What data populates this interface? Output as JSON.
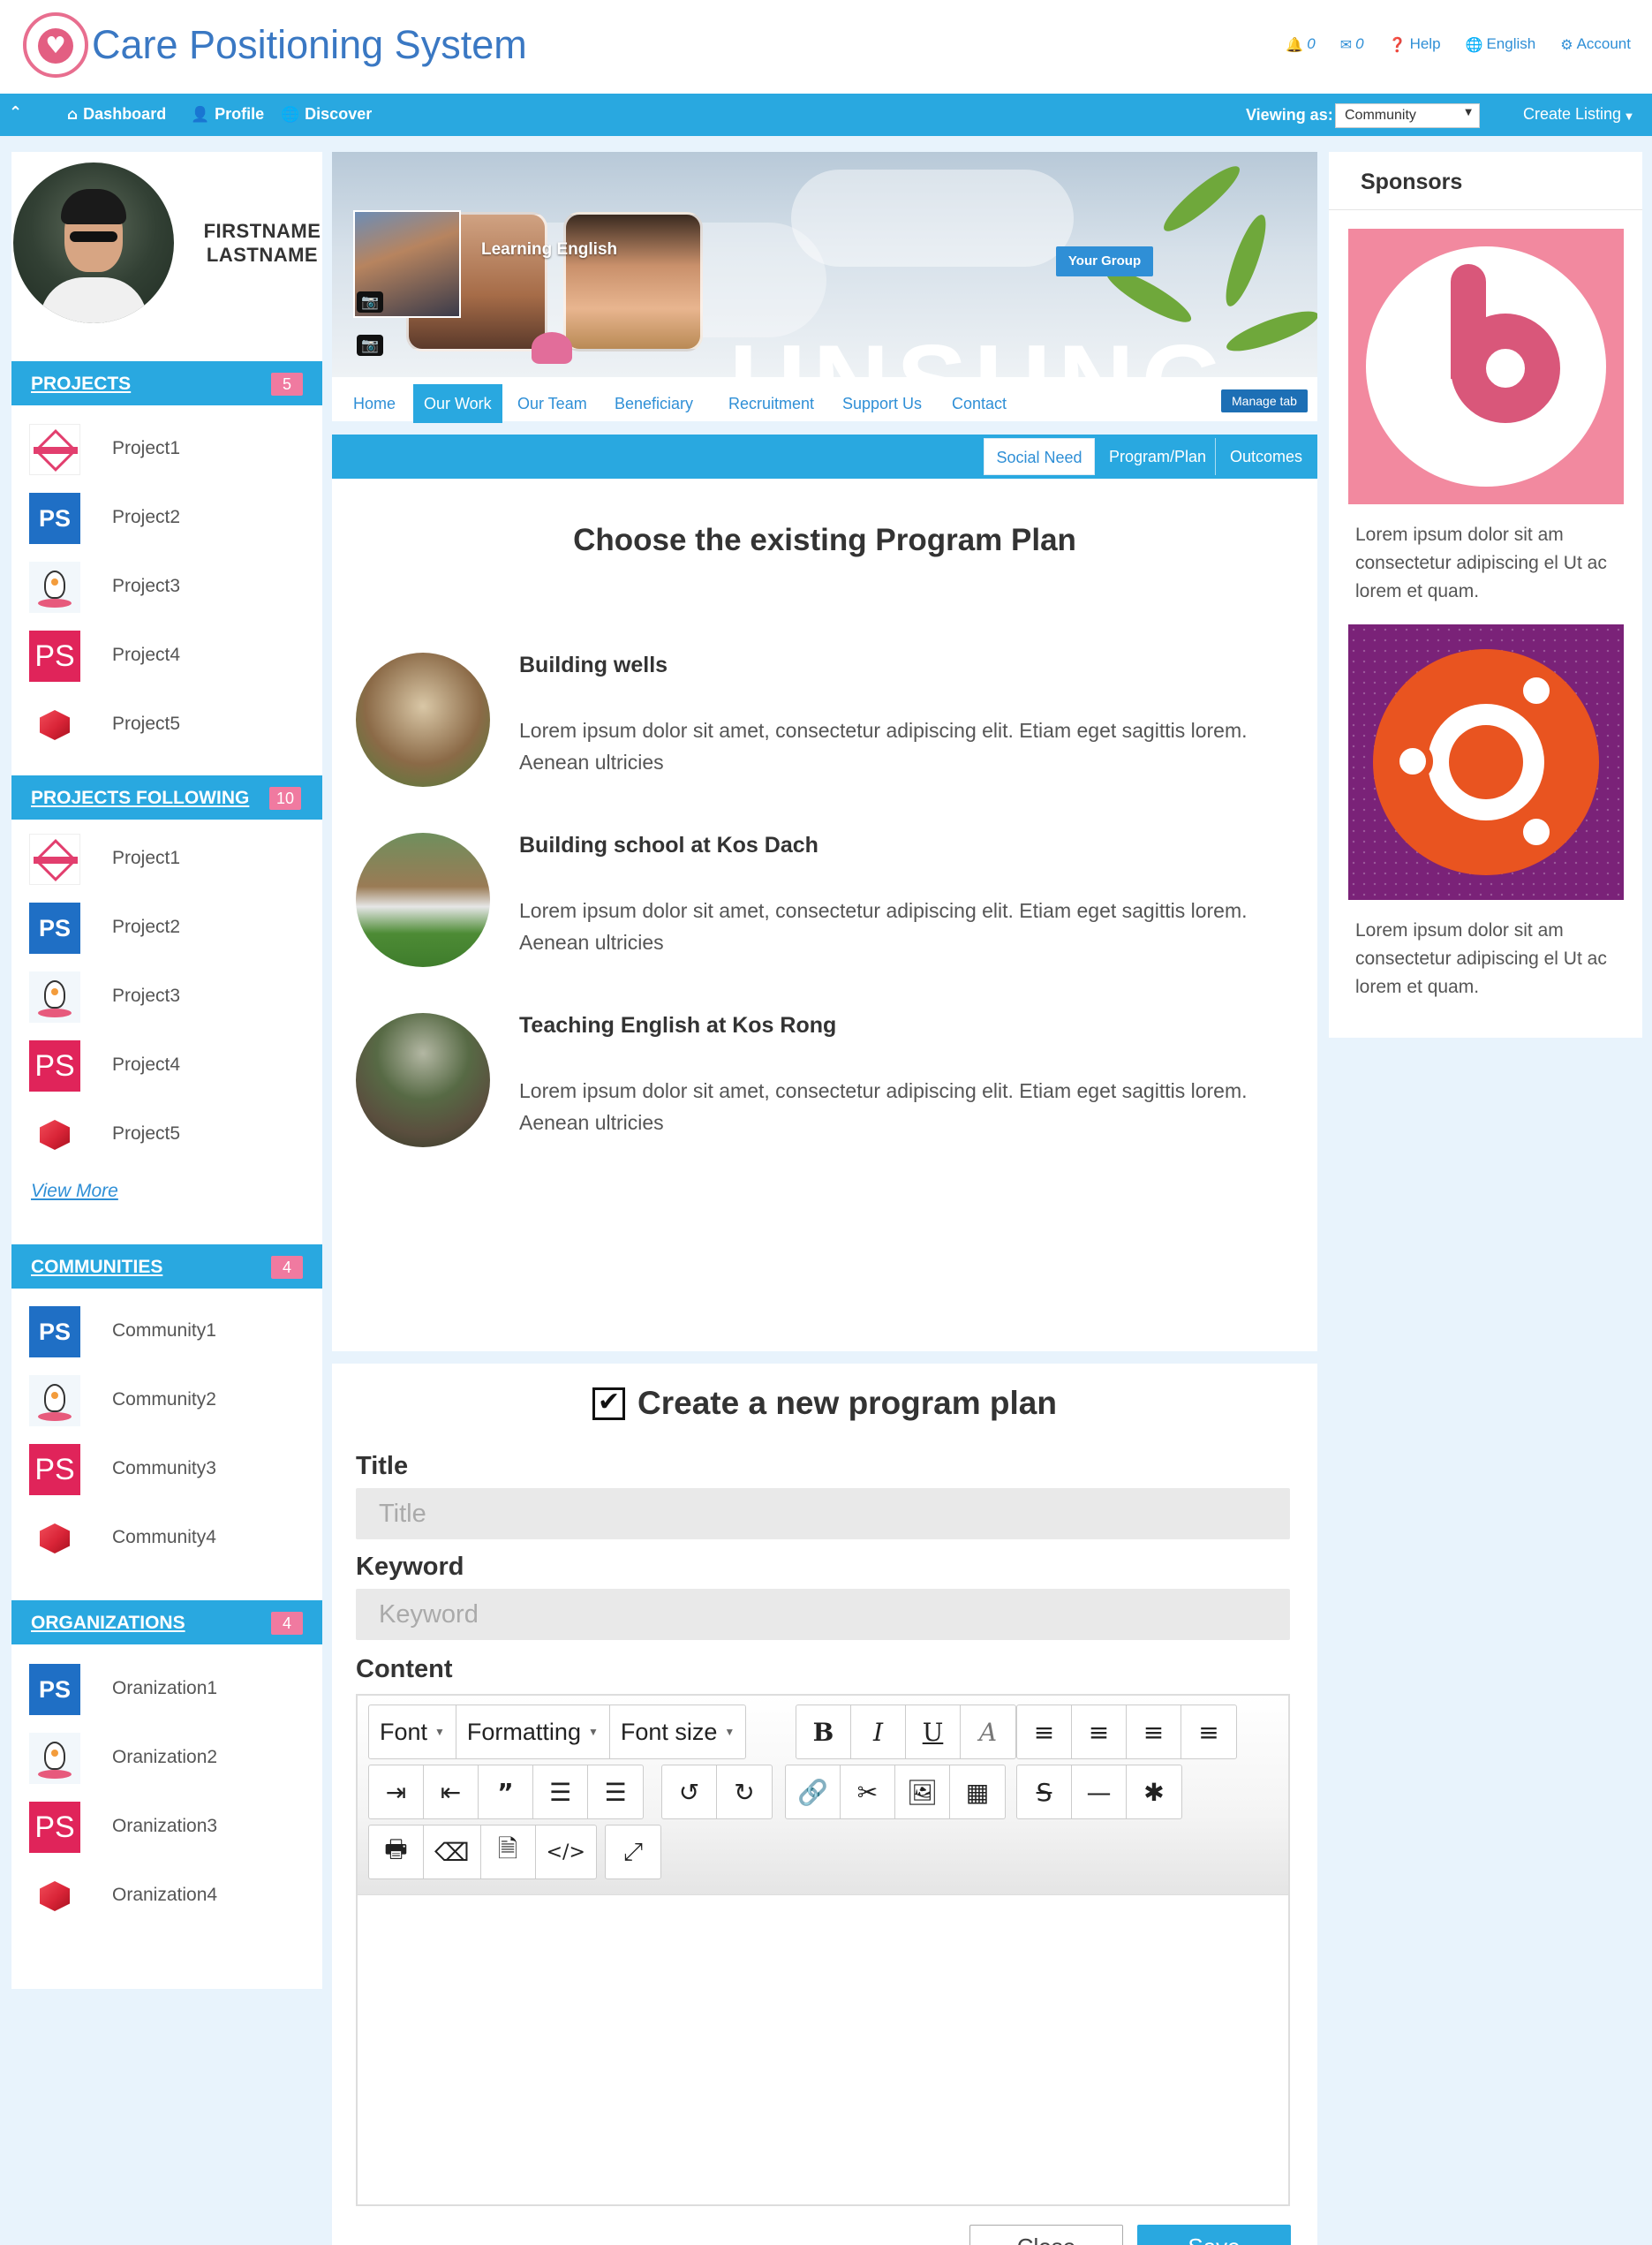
{
  "header": {
    "app_title": "Care Positioning System",
    "notifications_count": "0",
    "messages_count": "0",
    "help_label": "Help",
    "language_label": "English",
    "account_label": "Account"
  },
  "nav": {
    "dashboard_label": "Dashboard",
    "profile_label": "Profile",
    "discover_label": "Discover",
    "viewing_as_label": "Viewing as:",
    "viewing_as_value": "Community",
    "create_listing_label": "Create Listing"
  },
  "profile": {
    "firstname": "FIRSTNAME",
    "lastname": "LASTNAME"
  },
  "sidebar": {
    "projects": {
      "title": "PROJECTS",
      "count": "5",
      "items": [
        {
          "label": "Project1",
          "icon": "rady-ros-logo"
        },
        {
          "label": "Project2",
          "icon": "ps-blue-logo"
        },
        {
          "label": "Project3",
          "icon": "owl-logo"
        },
        {
          "label": "Project4",
          "icon": "ps-pink-logo"
        },
        {
          "label": "Project5",
          "icon": "red-cube-logo"
        }
      ]
    },
    "projects_following": {
      "title": "PROJECTS FOLLOWING",
      "count": "10",
      "items": [
        {
          "label": "Project1",
          "icon": "rady-ros-logo"
        },
        {
          "label": "Project2",
          "icon": "ps-blue-logo"
        },
        {
          "label": "Project3",
          "icon": "owl-logo"
        },
        {
          "label": "Project4",
          "icon": "ps-pink-logo"
        },
        {
          "label": "Project5",
          "icon": "red-cube-logo"
        }
      ],
      "view_more": "View More"
    },
    "communities": {
      "title": "COMMUNITIES",
      "count": "4",
      "items": [
        {
          "label": "Community1",
          "icon": "ps-blue-logo"
        },
        {
          "label": "Community2",
          "icon": "owl-logo"
        },
        {
          "label": "Community3",
          "icon": "ps-pink-logo"
        },
        {
          "label": "Community4",
          "icon": "red-cube-logo"
        }
      ]
    },
    "organizations": {
      "title": "ORGANIZATIONS",
      "count": "4",
      "items": [
        {
          "label": "Oranization1",
          "icon": "ps-blue-logo"
        },
        {
          "label": "Oranization2",
          "icon": "owl-logo"
        },
        {
          "label": "Oranization3",
          "icon": "ps-pink-logo"
        },
        {
          "label": "Oranization4",
          "icon": "red-cube-logo"
        }
      ]
    }
  },
  "cover": {
    "group_title": "Learning English",
    "your_group_label": "Your Group",
    "banner_text": "UNSUNG"
  },
  "tabs": [
    {
      "label": "Home",
      "active": false
    },
    {
      "label": "Our Work",
      "active": true
    },
    {
      "label": "Our Team",
      "active": false
    },
    {
      "label": "Beneficiary",
      "active": false
    },
    {
      "label": "Recruitment",
      "active": false
    },
    {
      "label": "Support Us",
      "active": false
    },
    {
      "label": "Contact",
      "active": false
    }
  ],
  "manage_tab_label": "Manage tab",
  "subtabs": [
    {
      "label": "Social Need",
      "active": true
    },
    {
      "label": "Program/Plan",
      "active": false
    },
    {
      "label": "Outcomes",
      "active": false
    }
  ],
  "existing_plans": {
    "heading": "Choose the existing Program Plan",
    "items": [
      {
        "title": "Building wells",
        "description": "Lorem ipsum dolor sit amet, consectetur adipiscing elit. Etiam eget sagittis lorem. Aenean ultricies"
      },
      {
        "title": "Building school at Kos Dach",
        "description": "Lorem ipsum dolor sit amet, consectetur adipiscing elit. Etiam eget sagittis lorem. Aenean ultricies"
      },
      {
        "title": "Teaching English at Kos Rong",
        "description": "Lorem ipsum dolor sit amet, consectetur adipiscing elit. Etiam eget sagittis lorem. Aenean ultricies"
      }
    ]
  },
  "create_plan": {
    "heading": "Create a new program plan",
    "checked": true,
    "title_label": "Title",
    "title_placeholder": "Title",
    "keyword_label": "Keyword",
    "keyword_placeholder": "Keyword",
    "content_label": "Content",
    "toolbar": {
      "font_label": "Font",
      "formatting_label": "Formatting",
      "font_size_label": "Font size"
    },
    "close_label": "Close",
    "save_label": "Save"
  },
  "sponsors": {
    "title": "Sponsors",
    "items": [
      {
        "logo": "beats-logo",
        "text": "Lorem ipsum dolor sit am consectetur adipiscing el Ut ac lorem et quam."
      },
      {
        "logo": "ubuntu-logo",
        "text": "Lorem ipsum dolor sit am consectetur adipiscing el Ut ac lorem et quam."
      }
    ]
  },
  "colors": {
    "primary": "#29a8e0",
    "link": "#2f8fd6",
    "badge": "#f07aa0",
    "page_background": "#e8f3fc"
  }
}
